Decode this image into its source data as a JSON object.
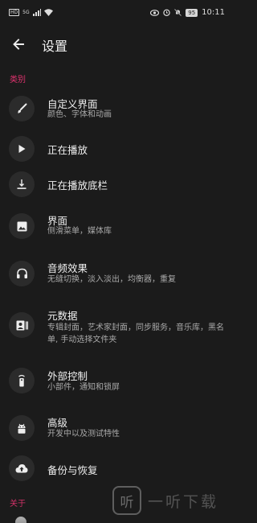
{
  "status_bar": {
    "left_badges": [
      "HD",
      "5G"
    ],
    "time": "10:11",
    "battery": "95"
  },
  "header": {
    "title": "设置"
  },
  "sections": {
    "category": "类别",
    "about": "关于"
  },
  "items": [
    {
      "icon": "paintbrush-icon",
      "title": "自定义界面",
      "subtitle": "颜色、字体和动画"
    },
    {
      "icon": "play-icon",
      "title": "正在播放",
      "subtitle": ""
    },
    {
      "icon": "bottom-bar-icon",
      "title": "正在播放底栏",
      "subtitle": ""
    },
    {
      "icon": "image-icon",
      "title": "界面",
      "subtitle": "侧滑菜单，媒体库"
    },
    {
      "icon": "headphones-icon",
      "title": "音频效果",
      "subtitle": "无缝切换，淡入淡出，均衡器，重复"
    },
    {
      "icon": "metadata-icon",
      "title": "元数据",
      "subtitle": "专辑封面，艺术家封面，同步服务，音乐库，黑名单, 手动选择文件夹"
    },
    {
      "icon": "remote-icon",
      "title": "外部控制",
      "subtitle": "小部件，通知和锁屏"
    },
    {
      "icon": "android-icon",
      "title": "高级",
      "subtitle": "开发中以及测试特性"
    },
    {
      "icon": "cloud-upload-icon",
      "title": "备份与恢复",
      "subtitle": ""
    }
  ],
  "watermark": {
    "logo_char": "听",
    "text": "一听下载"
  },
  "colors": {
    "background": "#1b1b1b",
    "accent": "#e0326e",
    "icon_circle": "#2b2b2b"
  }
}
